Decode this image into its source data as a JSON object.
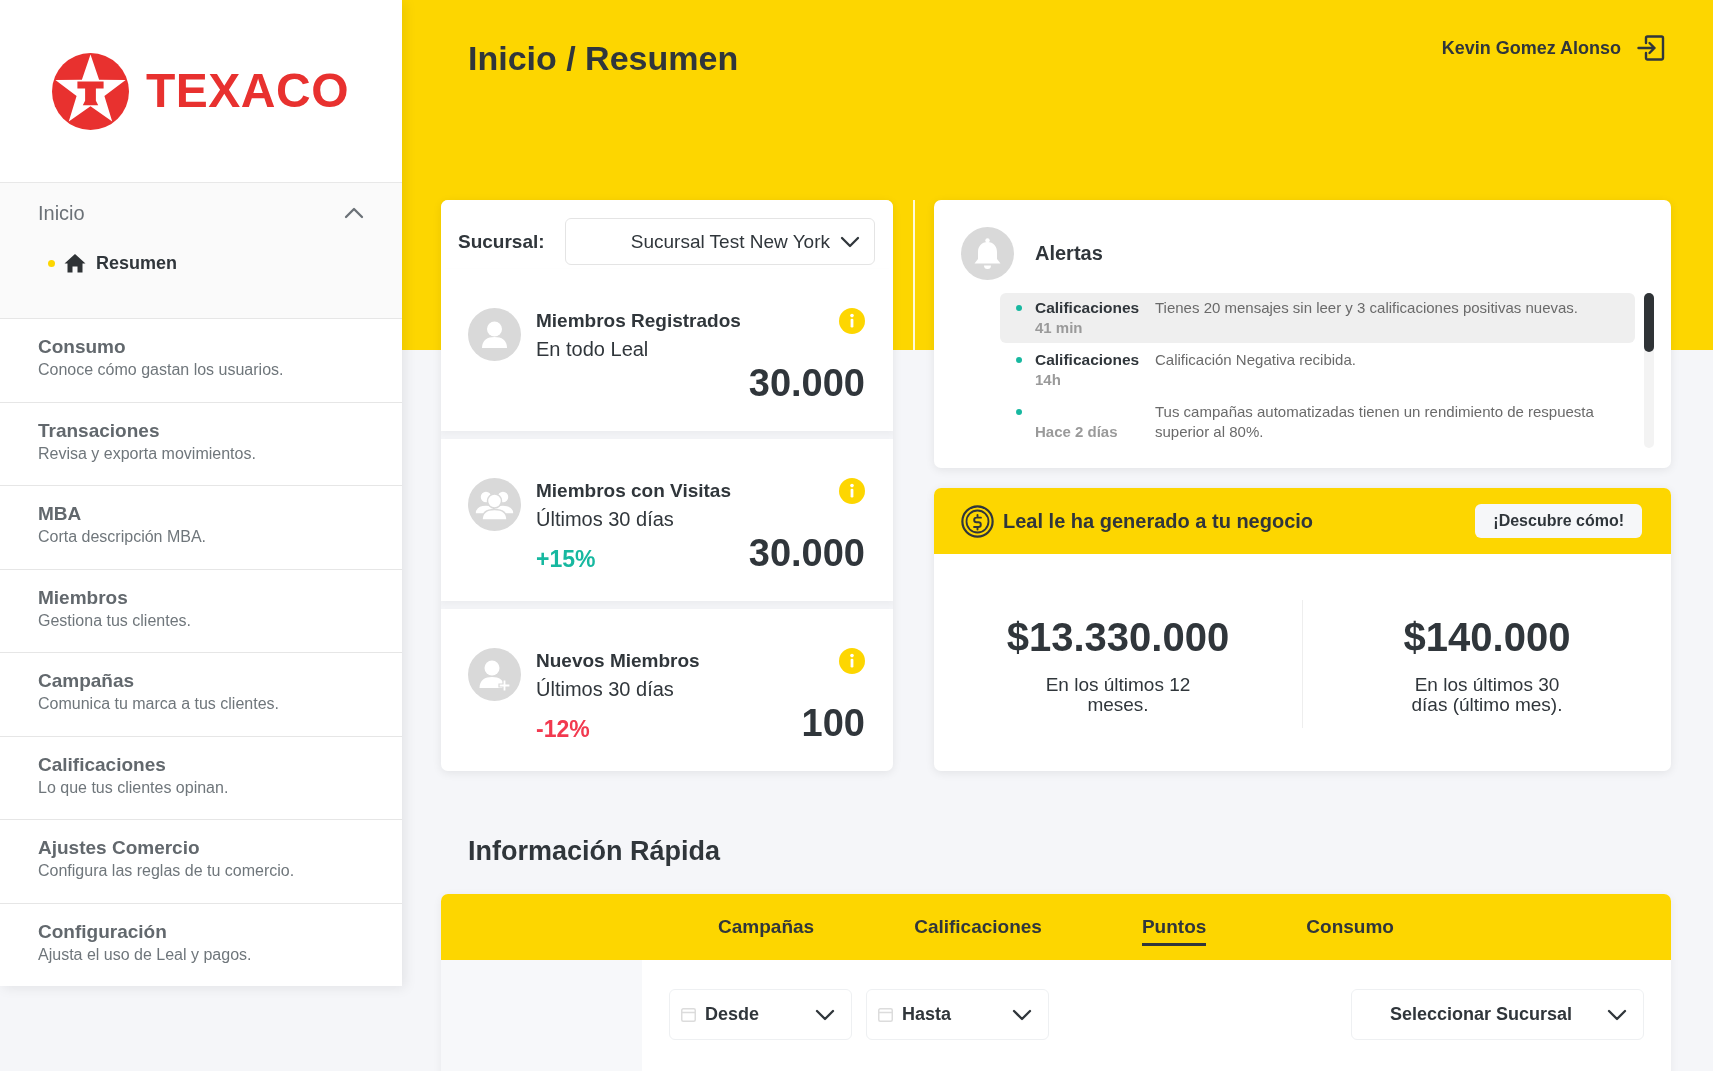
{
  "sidebar": {
    "logo_text": "TEXACO",
    "nav": [
      {
        "label": "Inicio",
        "selected": false,
        "expanded": true,
        "children": [
          {
            "label": "Resumen",
            "selected": true
          }
        ]
      },
      {
        "label": "Consumo",
        "description": "Conoce cómo gastan los usuarios.",
        "selected": false
      },
      {
        "label": "Transaciones",
        "description": "Revisa y exporta movimientos.",
        "selected": false
      },
      {
        "label": "MBA",
        "description": "Corta descripción MBA.",
        "selected": false
      },
      {
        "label": "Miembros",
        "description": "Gestiona tus clientes.",
        "selected": false
      },
      {
        "label": "Campañas",
        "description": "Comunica tu marca a tus clientes.",
        "selected": false
      },
      {
        "label": "Calificaciones",
        "description": "Lo que tus clientes opinan.",
        "selected": false
      },
      {
        "label": "Ajustes Comercio",
        "description": "Configura las reglas de tu comercio.",
        "selected": false
      },
      {
        "label": "Configuración",
        "description": "Ajusta el uso de Leal y pagos.",
        "selected": false
      }
    ]
  },
  "header": {
    "title": "Inicio / Resumen",
    "user_name": "Kevin Gomez Alonso"
  },
  "branch_filter": {
    "label": "Sucursal:",
    "value": "Sucursal Test New York"
  },
  "stats": [
    {
      "kind": "user",
      "title": "Miembros Registrados",
      "subtitle": "En todo Leal",
      "value": "30.000"
    },
    {
      "kind": "group",
      "title": "Miembros con Visitas",
      "subtitle": "Últimos 30 días",
      "value": "30.000",
      "change": "+15%",
      "color": "#17b8a0"
    },
    {
      "kind": "user-add",
      "title": "Nuevos Miembros",
      "subtitle": "Últimos 30 días",
      "value": "100",
      "change": "-12%",
      "color": "#f2394f"
    }
  ],
  "alerts": {
    "title": "Alertas",
    "items": [
      {
        "category": "Calificaciones",
        "time": "41 min",
        "message": "Tienes 20 mensajes sin leer y 3 calificaciones positivas nuevas.",
        "selected": true
      },
      {
        "category": "Calificaciones",
        "time": "14h",
        "message": "Calificación Negativa recibida.",
        "selected": false
      },
      {
        "time": "Hace 2 días",
        "message": "Tus campañas automatizadas tienen un rendimiento de respuesta superior al 80%.",
        "selected": false
      }
    ]
  },
  "revenue": {
    "title": "Leal le ha generado a tu negocio",
    "action": "¡Descubre cómo!",
    "figures": [
      {
        "value": "$13.330.000",
        "caption": "En los últimos 12 meses."
      },
      {
        "value": "$140.000",
        "caption": "En los últimos 30 días (último mes)."
      }
    ]
  },
  "quick_info": {
    "title": "Información Rápida",
    "tabs": [
      {
        "label": "Campañas",
        "selected": false
      },
      {
        "label": "Calificaciones",
        "selected": false
      },
      {
        "label": "Puntos",
        "selected": true
      },
      {
        "label": "Consumo",
        "selected": false
      }
    ],
    "filters": [
      {
        "kind": "date",
        "label": "Desde"
      },
      {
        "kind": "date",
        "label": "Hasta"
      },
      {
        "kind": "select",
        "label": "Seleccionar Sucursal"
      }
    ]
  }
}
